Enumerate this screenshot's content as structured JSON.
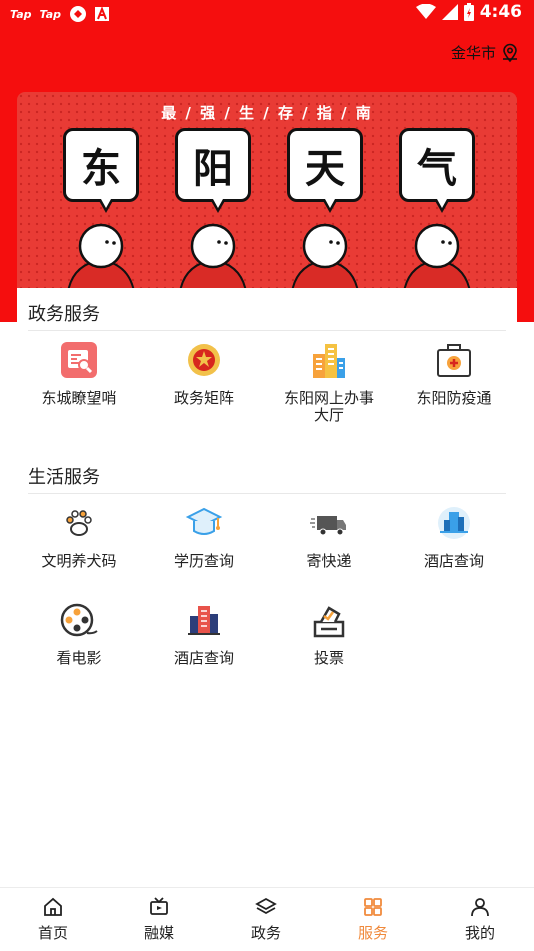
{
  "status_bar": {
    "left_tags": [
      "Tap",
      "Tap"
    ],
    "time": "4:46"
  },
  "header": {
    "city": "金华市"
  },
  "banner": {
    "title": "最 / 强 / 生 / 存 / 指 / 南",
    "bubbles": [
      "东",
      "阳",
      "天",
      "气"
    ]
  },
  "sections": [
    {
      "title": "政务服务",
      "items": [
        {
          "label": "东城瞭望哨",
          "icon": "search-document-icon"
        },
        {
          "label": "政务矩阵",
          "icon": "national-emblem-icon"
        },
        {
          "label": "东阳网上办事大厅",
          "icon": "buildings-icon"
        },
        {
          "label": "东阳防疫通",
          "icon": "medical-kit-icon"
        }
      ]
    },
    {
      "title": "生活服务",
      "items": [
        {
          "label": "文明养犬码",
          "icon": "paw-icon"
        },
        {
          "label": "学历查询",
          "icon": "graduation-cap-icon"
        },
        {
          "label": "寄快递",
          "icon": "delivery-truck-icon"
        },
        {
          "label": "酒店查询",
          "icon": "hotel-building-icon"
        },
        {
          "label": "看电影",
          "icon": "film-reel-icon"
        },
        {
          "label": "酒店查询",
          "icon": "city-buildings-icon"
        },
        {
          "label": "投票",
          "icon": "ballot-box-icon"
        }
      ]
    }
  ],
  "tabbar": {
    "tabs": [
      {
        "label": "首页",
        "icon": "home-icon"
      },
      {
        "label": "融媒",
        "icon": "tv-icon"
      },
      {
        "label": "政务",
        "icon": "layers-icon"
      },
      {
        "label": "服务",
        "icon": "grid-icon",
        "active": true
      },
      {
        "label": "我的",
        "icon": "user-icon"
      }
    ]
  },
  "colors": {
    "brand_red": "#f50e0e",
    "active_tab": "#f08a3c"
  }
}
